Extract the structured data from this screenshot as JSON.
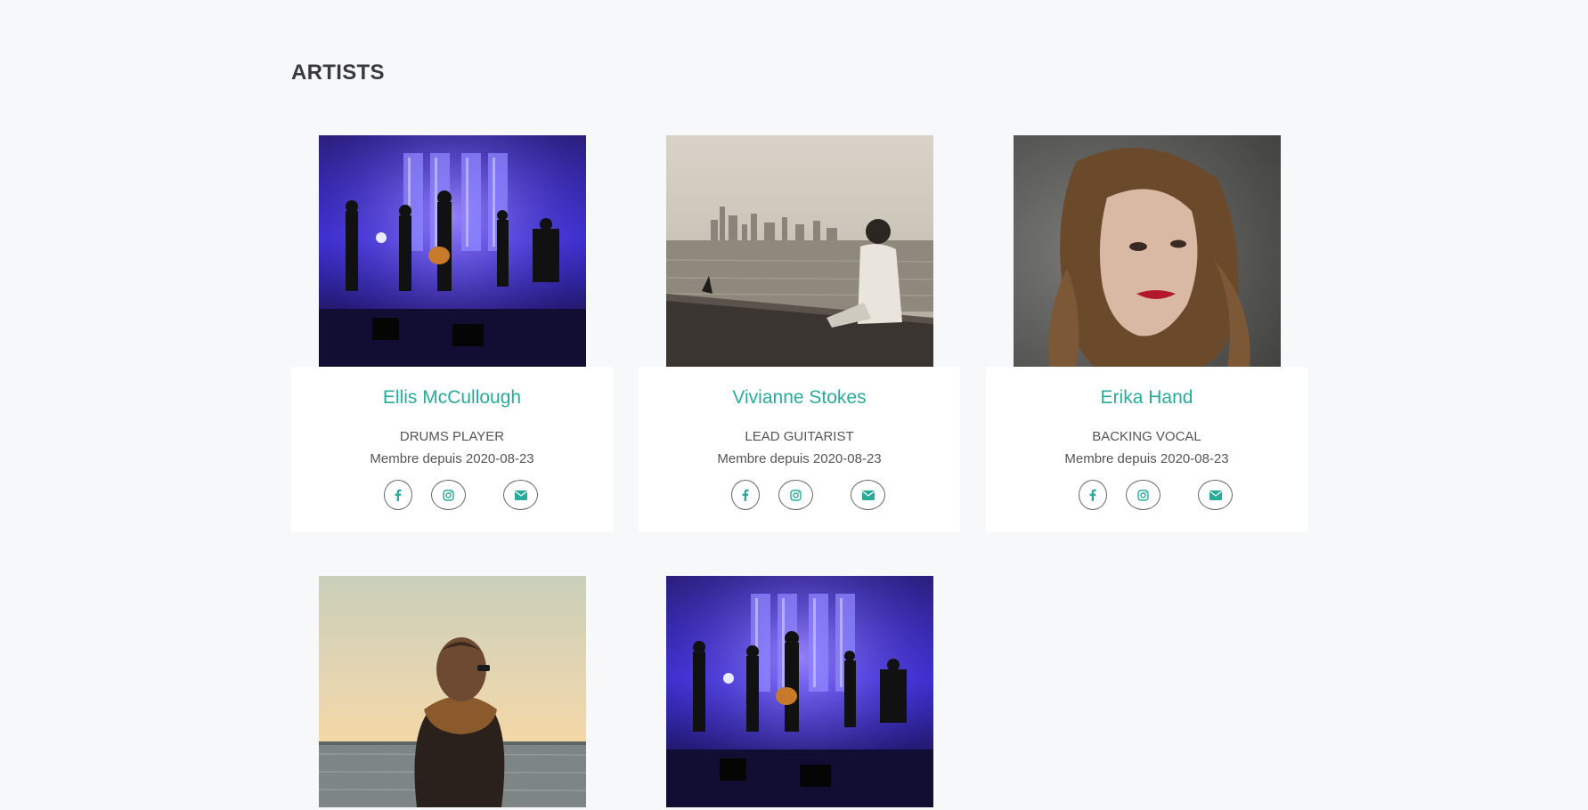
{
  "page": {
    "title": "ARTISTS"
  },
  "artists": [
    {
      "name": "Ellis McCullough",
      "role": "DRUMS PLAYER",
      "since": "Membre depuis 2020-08-23",
      "photo": "band-on-stage-photo"
    },
    {
      "name": "Vivianne Stokes",
      "role": "LEAD GUITARIST",
      "since": "Membre depuis 2020-08-23",
      "photo": "man-by-lake-city-skyline-photo"
    },
    {
      "name": "Erika Hand",
      "role": "BACKING VOCAL",
      "since": "Membre depuis 2020-08-23",
      "photo": "woman-portrait-photo"
    },
    {
      "photo": "person-with-scarf-by-sea-photo"
    },
    {
      "photo": "band-on-stage-photo"
    }
  ],
  "social_icons": [
    "facebook-icon",
    "instagram-icon",
    "envelope-icon"
  ],
  "colors": {
    "accent": "#2aab9a",
    "background": "#f7f8fa",
    "card": "#ffffff",
    "text": "#555555"
  }
}
